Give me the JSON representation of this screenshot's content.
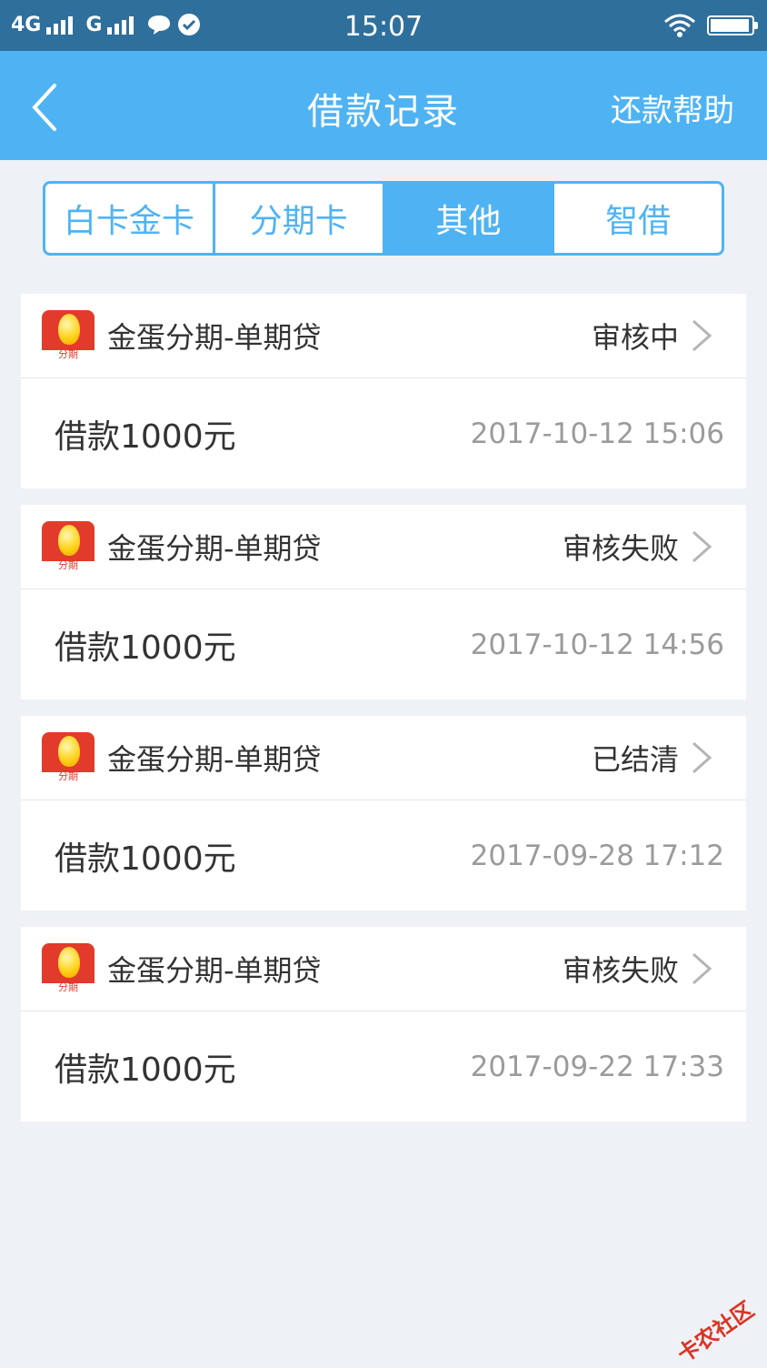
{
  "status_bar": {
    "network_4g": "4G",
    "network_g": "G",
    "time": "15:07",
    "battery_level": 0.95
  },
  "nav": {
    "title": "借款记录",
    "help": "还款帮助",
    "back_icon": "chevron-left-icon"
  },
  "tabs": [
    {
      "label": "白卡金卡",
      "active": false
    },
    {
      "label": "分期卡",
      "active": false
    },
    {
      "label": "其他",
      "active": true
    },
    {
      "label": "智借",
      "active": false
    }
  ],
  "records": [
    {
      "logo_text": "分期",
      "product": "金蛋分期-单期贷",
      "status": "审核中",
      "amount": "借款1000元",
      "datetime": "2017-10-12 15:06"
    },
    {
      "logo_text": "分期",
      "product": "金蛋分期-单期贷",
      "status": "审核失败",
      "amount": "借款1000元",
      "datetime": "2017-10-12 14:56"
    },
    {
      "logo_text": "分期",
      "product": "金蛋分期-单期贷",
      "status": "已结清",
      "amount": "借款1000元",
      "datetime": "2017-09-28 17:12"
    },
    {
      "logo_text": "分期",
      "product": "金蛋分期-单期贷",
      "status": "审核失败",
      "amount": "借款1000元",
      "datetime": "2017-09-22 17:33"
    }
  ],
  "watermark": "卡农社区",
  "colors": {
    "status_bar": "#2f6f9c",
    "nav_bar": "#4fb3f3",
    "accent": "#4fb3f3",
    "background": "#eef2f6",
    "logo_red": "#e23b2b"
  }
}
